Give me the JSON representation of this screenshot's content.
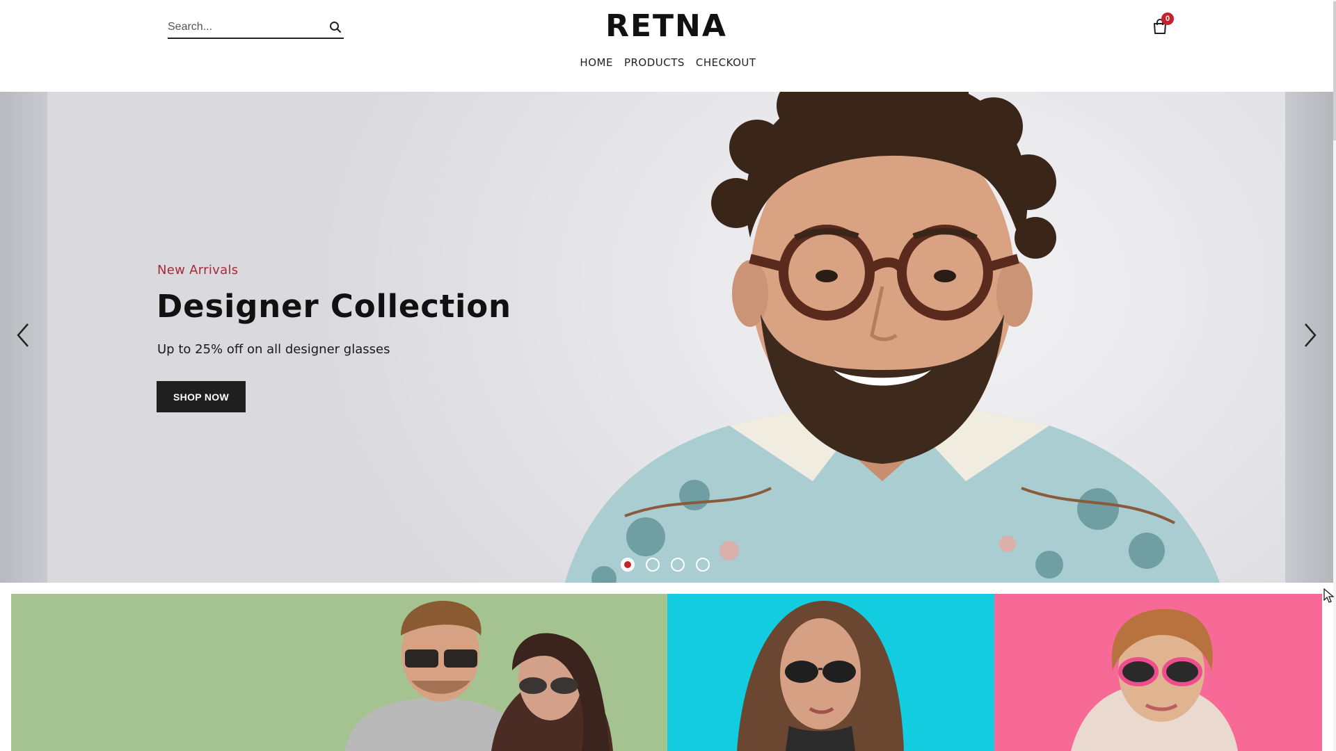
{
  "header": {
    "search": {
      "placeholder": "Search...",
      "value": ""
    },
    "logo": "RETNA",
    "nav": [
      {
        "label": "HOME"
      },
      {
        "label": "PRODUCTS"
      },
      {
        "label": "CHECKOUT"
      }
    ],
    "cart": {
      "count": "0",
      "icon": "shopping-bag-icon"
    }
  },
  "hero": {
    "kicker": "New Arrivals",
    "title": "Designer Collection",
    "subtitle": "Up to 25% off on all designer glasses",
    "button_label": "SHOP NOW",
    "slides_total": 4,
    "active_slide": 1
  },
  "banners": [
    {
      "name": "couple-sunglasses",
      "color": "#a5c391"
    },
    {
      "name": "woman-sunglasses",
      "color": "#13ccdf"
    },
    {
      "name": "kid-sunglasses",
      "color": "#f76a98"
    }
  ],
  "colors": {
    "accent": "#c4232c",
    "kicker": "#a8293a",
    "button": "#1f1f1f"
  }
}
